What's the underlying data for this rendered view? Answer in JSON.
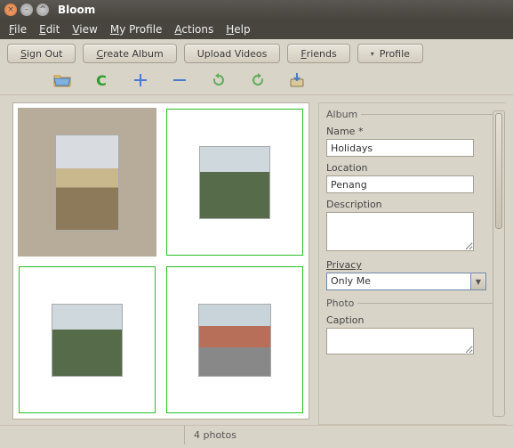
{
  "window": {
    "title": "Bloom"
  },
  "menubar": [
    "File",
    "Edit",
    "View",
    "My Profile",
    "Actions",
    "Help"
  ],
  "toolbar": {
    "sign_out": "Sign Out",
    "create_album": "Create Album",
    "upload_videos": "Upload Videos",
    "friends": "Friends",
    "profile": "Profile"
  },
  "icon_tools": {
    "open": "open-folder-icon",
    "refresh": "refresh-icon",
    "add": "plus-icon",
    "remove": "minus-icon",
    "rotate_left": "rotate-left-icon",
    "rotate_right": "rotate-right-icon",
    "export": "export-icon"
  },
  "album": {
    "section": "Album",
    "name_label": "Name",
    "name_value": "Holidays",
    "location_label": "Location",
    "location_value": "Penang",
    "description_label": "Description",
    "description_value": "",
    "privacy_label": "Privacy",
    "privacy_value": "Only Me"
  },
  "photo": {
    "section": "Photo",
    "caption_label": "Caption",
    "caption_value": ""
  },
  "status": {
    "count": "4 photos"
  }
}
